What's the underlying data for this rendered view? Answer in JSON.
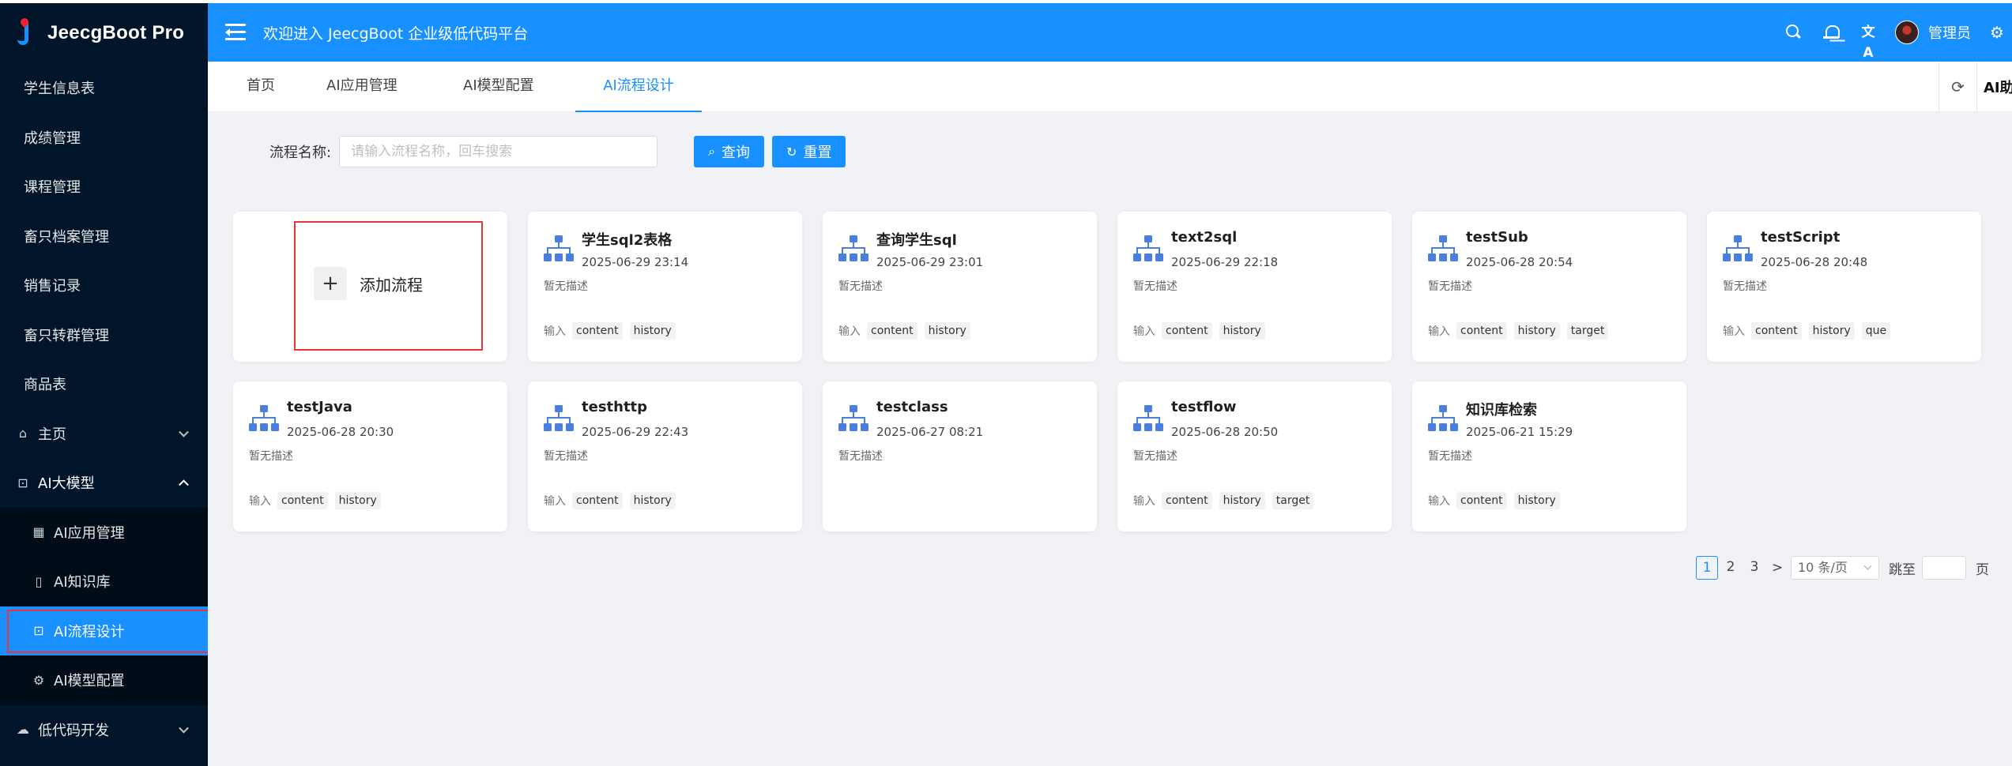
{
  "app": {
    "name": "JeecgBoot Pro"
  },
  "sidebar": {
    "items": [
      {
        "label": "学生信息表"
      },
      {
        "label": "成绩管理"
      },
      {
        "label": "课程管理"
      },
      {
        "label": "畜只档案管理"
      },
      {
        "label": "销售记录"
      },
      {
        "label": "畜只转群管理"
      },
      {
        "label": "商品表"
      }
    ],
    "groups": {
      "home": {
        "label": "主页",
        "icon": "home-icon"
      },
      "ai": {
        "label": "AI大模型",
        "icon": "ai-icon"
      },
      "lowcode": {
        "label": "低代码开发",
        "icon": "cloud-icon"
      }
    },
    "ai_children": [
      {
        "label": "AI应用管理",
        "icon": "grid-icon"
      },
      {
        "label": "AI知识库",
        "icon": "book-icon"
      },
      {
        "label": "AI流程设计",
        "icon": "flow-icon",
        "active": true
      },
      {
        "label": "AI模型配置",
        "icon": "gear-icon"
      }
    ]
  },
  "header": {
    "welcome": "欢迎进入 JeecgBoot 企业级低代码平台",
    "lang_icon": "文A",
    "user": "管理员"
  },
  "tabs": {
    "items": [
      {
        "label": "首页"
      },
      {
        "label": "AI应用管理"
      },
      {
        "label": "AI模型配置"
      },
      {
        "label": "AI流程设计",
        "active": true
      }
    ],
    "helper": "AI助手"
  },
  "search": {
    "label": "流程名称:",
    "placeholder": "请输入流程名称，回车搜索",
    "query_label": "查询",
    "reset_label": "重置"
  },
  "add_card": {
    "label": "添加流程"
  },
  "input_label": "输入",
  "flows": [
    {
      "title": "学生sql2表格",
      "date": "2025-06-29 23:14",
      "desc": "暂无描述",
      "tags": [
        "content",
        "history"
      ]
    },
    {
      "title": "查询学生sql",
      "date": "2025-06-29 23:01",
      "desc": "暂无描述",
      "tags": [
        "content",
        "history"
      ]
    },
    {
      "title": "text2sql",
      "date": "2025-06-29 22:18",
      "desc": "暂无描述",
      "tags": [
        "content",
        "history"
      ]
    },
    {
      "title": "testSub",
      "date": "2025-06-28 20:54",
      "desc": "暂无描述",
      "tags": [
        "content",
        "history",
        "target"
      ]
    },
    {
      "title": "testScript",
      "date": "2025-06-28 20:48",
      "desc": "暂无描述",
      "tags": [
        "content",
        "history",
        "que"
      ]
    },
    {
      "title": "testJava",
      "date": "2025-06-28 20:30",
      "desc": "暂无描述",
      "tags": [
        "content",
        "history"
      ]
    },
    {
      "title": "testhttp",
      "date": "2025-06-29 22:43",
      "desc": "暂无描述",
      "tags": [
        "content",
        "history"
      ]
    },
    {
      "title": "testclass",
      "date": "2025-06-27 08:21",
      "desc": "暂无描述",
      "tags": []
    },
    {
      "title": "testflow",
      "date": "2025-06-28 20:50",
      "desc": "暂无描述",
      "tags": [
        "content",
        "history",
        "target"
      ]
    },
    {
      "title": "知识库检索",
      "date": "2025-06-21 15:29",
      "desc": "暂无描述",
      "tags": [
        "content",
        "history"
      ]
    }
  ],
  "pagination": {
    "pages": [
      "1",
      "2",
      "3"
    ],
    "current": "1",
    "next": ">",
    "page_size": "10 条/页",
    "jump_label": "跳至",
    "page_unit": "页"
  },
  "colors": {
    "primary": "#1890ff",
    "sidebar_bg": "#001529",
    "highlight": "#e8343a"
  }
}
